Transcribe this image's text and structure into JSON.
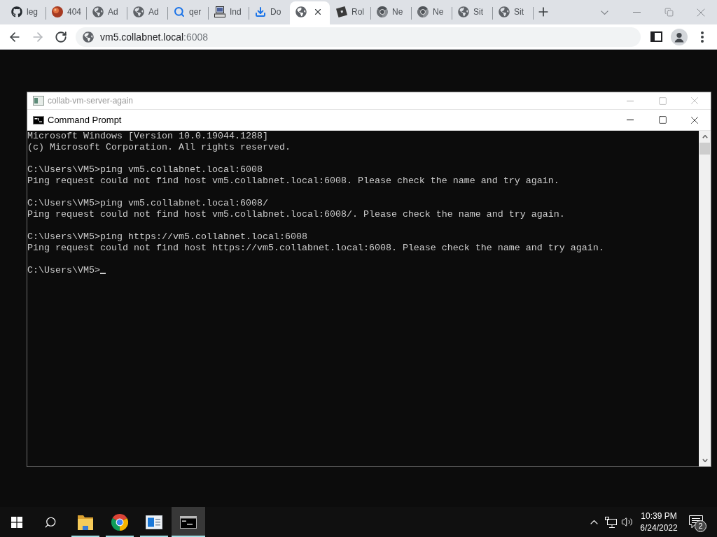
{
  "browser": {
    "tabs": [
      {
        "kind": "github",
        "title": "leg",
        "selected": false
      },
      {
        "kind": "ball",
        "title": "404",
        "selected": false
      },
      {
        "kind": "globe",
        "title": "Ad",
        "selected": false
      },
      {
        "kind": "globe",
        "title": "Ad",
        "selected": false
      },
      {
        "kind": "search",
        "title": "qer",
        "selected": false
      },
      {
        "kind": "computer",
        "title": "Ind",
        "selected": false
      },
      {
        "kind": "download",
        "title": "Do",
        "selected": false
      },
      {
        "kind": "globe",
        "selected": true
      },
      {
        "kind": "square",
        "title": "Rol",
        "selected": false
      },
      {
        "kind": "chrome",
        "title": "Ne",
        "selected": false
      },
      {
        "kind": "chrome",
        "title": "Ne",
        "selected": false
      },
      {
        "kind": "globe",
        "title": "Sit",
        "selected": false
      },
      {
        "kind": "globe",
        "title": "Sit",
        "selected": false
      }
    ],
    "toolbar": {
      "back_disabled": false,
      "forward_disabled": true
    },
    "address_bar": {
      "host": "vm5.collabnet.local",
      "port": ":6008"
    }
  },
  "vm_window": {
    "title": "collab-vm-server-again",
    "active": false
  },
  "console_window": {
    "title": "Command Prompt",
    "active": true,
    "output_blocks": [
      [
        "Microsoft Windows [Version 10.0.19044.1288]",
        "(c) Microsoft Corporation. All rights reserved."
      ],
      [
        "C:\\Users\\VM5>ping vm5.collabnet.local:6008",
        "Ping request could not find host vm5.collabnet.local:6008. Please check the name and try again."
      ],
      [
        "C:\\Users\\VM5>ping vm5.collabnet.local:6008/",
        "Ping request could not find host vm5.collabnet.local:6008/. Please check the name and try again."
      ],
      [
        "C:\\Users\\VM5>ping https://vm5.collabnet.local:6008",
        "Ping request could not find host https://vm5.collabnet.local:6008. Please check the name and try again."
      ]
    ],
    "prompt": "C:\\Users\\VM5>",
    "cursor_visible": true
  },
  "taskbar": {
    "apps": [
      {
        "kind": "folder",
        "running": true,
        "selected": false
      },
      {
        "kind": "browser",
        "running": true,
        "selected": false
      },
      {
        "kind": "window",
        "running": true,
        "selected": false
      },
      {
        "kind": "terminal",
        "running": true,
        "selected": true
      }
    ],
    "clock": {
      "time": "10:39 PM",
      "date": "6/24/2022"
    },
    "notification_count": "2"
  }
}
